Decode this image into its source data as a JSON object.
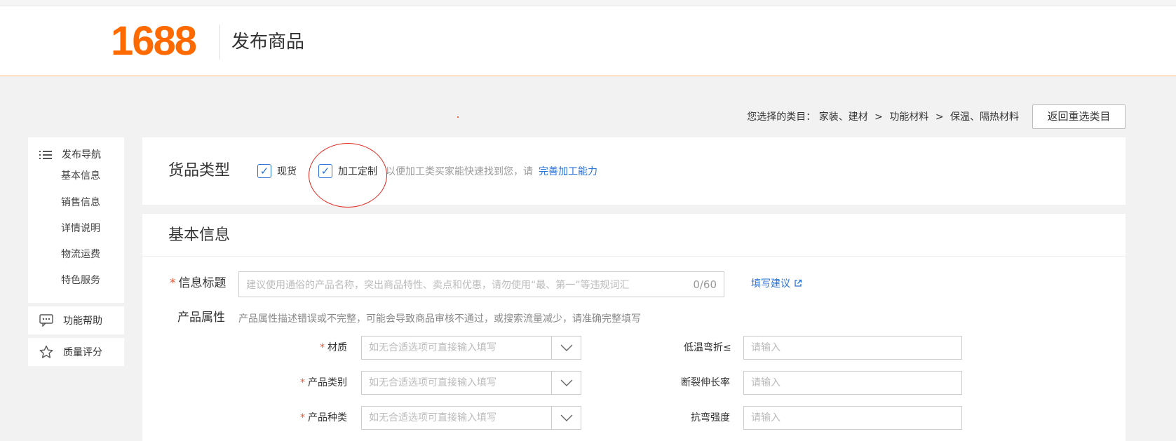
{
  "header": {
    "logo": "1688",
    "title": "发布商品"
  },
  "category": {
    "prefix": "您选择的类目：",
    "path": [
      "家装、建材",
      "功能材料",
      "保温、隔热材料"
    ],
    "separator": ">",
    "reselect_label": "返回重选类目"
  },
  "sidenav": {
    "title": "发布导航",
    "items": [
      "基本信息",
      "销售信息",
      "详情说明",
      "物流运费",
      "特色服务"
    ],
    "help_label": "功能帮助",
    "quality_label": "质量评分"
  },
  "goods_type": {
    "title": "货品类型",
    "options": [
      {
        "label": "现货",
        "checked": true
      },
      {
        "label": "加工定制",
        "checked": true
      }
    ],
    "hint": "以便加工类买家能快速找到您，请",
    "link": "完善加工能力"
  },
  "basic": {
    "title": "基本信息",
    "info_title_label": "信息标题",
    "info_title_placeholder": "建议使用通俗的产品名称，突出商品特性、卖点和优惠，请勿使用“最、第一”等违规词汇",
    "info_title_count": "0/60",
    "suggest_link": "填写建议",
    "attr_label": "产品属性",
    "attr_hint": "产品属性描述错误或不完整，可能会导致商品审核不通过，或搜索流量减少，请准确完整填写",
    "left_fields": [
      {
        "label": "材质",
        "required": true,
        "placeholder": "如无合适选项可直接输入填写"
      },
      {
        "label": "产品类别",
        "required": true,
        "placeholder": "如无合适选项可直接输入填写"
      },
      {
        "label": "产品种类",
        "required": true,
        "placeholder": "如无合适选项可直接输入填写"
      }
    ],
    "right_fields": [
      {
        "label": "低温弯折≤",
        "placeholder": "请输入"
      },
      {
        "label": "断裂伸长率",
        "placeholder": "请输入"
      },
      {
        "label": "抗弯强度",
        "placeholder": "请输入"
      }
    ],
    "required_mark": "*"
  },
  "colors": {
    "brand": "#ff6a00",
    "link": "#2a72d8",
    "required": "#e53333",
    "annotation_circle": "#e0281e"
  }
}
